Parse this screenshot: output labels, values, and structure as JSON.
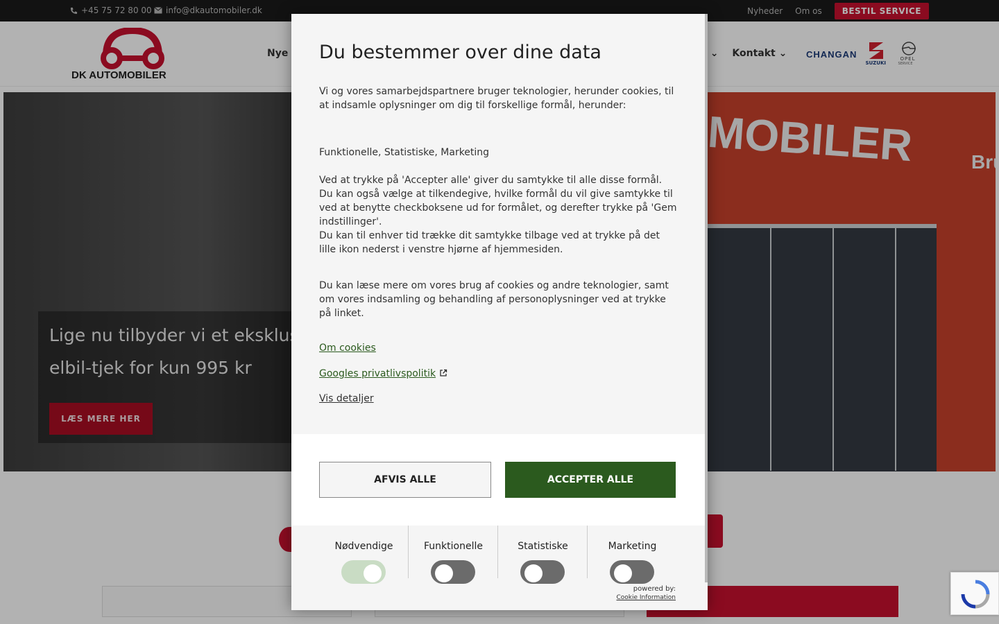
{
  "topbar": {
    "phone": "+45 75 72 80 00",
    "email": "info@dkautomobiler.dk",
    "links": [
      "Nyheder",
      "Om os"
    ],
    "cta": "BESTIL SERVICE"
  },
  "header": {
    "logo_text": "DK AUTOMOBILER",
    "nav_left": "Nye b",
    "nav_right": [
      "l",
      "Kontakt"
    ],
    "brand_changan": "CHANGAN",
    "brand_suzuki": "SUZUKI",
    "brand_opel": "OPEL",
    "brand_opel_sub": "SERVICE"
  },
  "hero": {
    "line1": "Lige nu tilbyder vi et eksklusiv",
    "line2": "elbil-tjek for kun 995 kr",
    "button": "LÆS MERE HER",
    "sign": "MOBILER",
    "sign_side": "Bru"
  },
  "colors": {
    "brand_red": "#c8102e",
    "accept_green": "#2b5a1e",
    "topbar_bg": "#1a1a1a"
  },
  "modal": {
    "title": "Du bestemmer over dine data",
    "intro": "Vi og vores samarbejdspartnere bruger teknologier, herunder cookies, til at indsamle oplysninger om dig til forskellige formål, herunder:",
    "purposes": "Funktionelle, Statistiske, Marketing",
    "para_accept": "Ved at trykke på 'Accepter alle' giver du samtykke til alle disse formål. Du kan også vælge at tilkendegive, hvilke formål du vil give samtykke til ved at benytte checkboksene ud for formålet, og derefter trykke på 'Gem indstillinger'.",
    "para_withdraw": "Du kan til enhver tid trække dit samtykke tilbage ved at trykke på det lille ikon nederst i venstre hjørne af hjemmesiden.",
    "para_read": "Du kan læse mere om vores brug af cookies og andre teknologier, samt om vores indsamling og behandling af personoplysninger ved at trykke på linket.",
    "link_cookies": "Om cookies",
    "link_google": "Googles privatlivspolitik",
    "link_details": "Vis detaljer",
    "btn_reject": "AFVIS ALLE",
    "btn_accept": "ACCEPTER ALLE",
    "toggles": [
      {
        "label": "Nødvendige",
        "on": true
      },
      {
        "label": "Funktionelle",
        "on": false
      },
      {
        "label": "Statistiske",
        "on": false
      },
      {
        "label": "Marketing",
        "on": false
      }
    ],
    "powered_by": "powered by:",
    "powered_brand": "Cookie Information"
  }
}
